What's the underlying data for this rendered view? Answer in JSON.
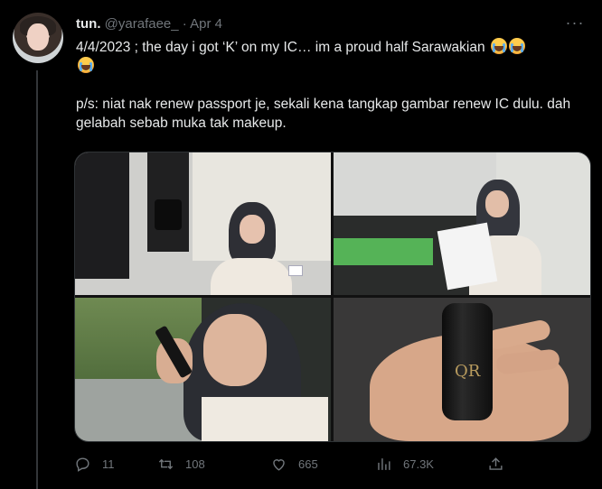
{
  "author": {
    "name": "tun.",
    "handle": "@yarafaee_",
    "separator": "·",
    "date": "Apr 4"
  },
  "tweet": {
    "line1": "4/4/2023 ; the day i got ‘K’ on my IC… im a proud half Sarawakian",
    "line2": "p/s: niat nak renew passport je, sekali kena tangkap gambar renew IC dulu. dah gelabah sebab muka tak makeup.",
    "emoji": "loudly-crying-face"
  },
  "media": {
    "product_logo": "QR"
  },
  "actions": {
    "replies": "11",
    "retweets": "108",
    "likes": "665",
    "views": "67.3K"
  },
  "colors": {
    "background": "#000000",
    "text": "#e7e9ea",
    "muted": "#71767b",
    "border": "#2f3336"
  }
}
